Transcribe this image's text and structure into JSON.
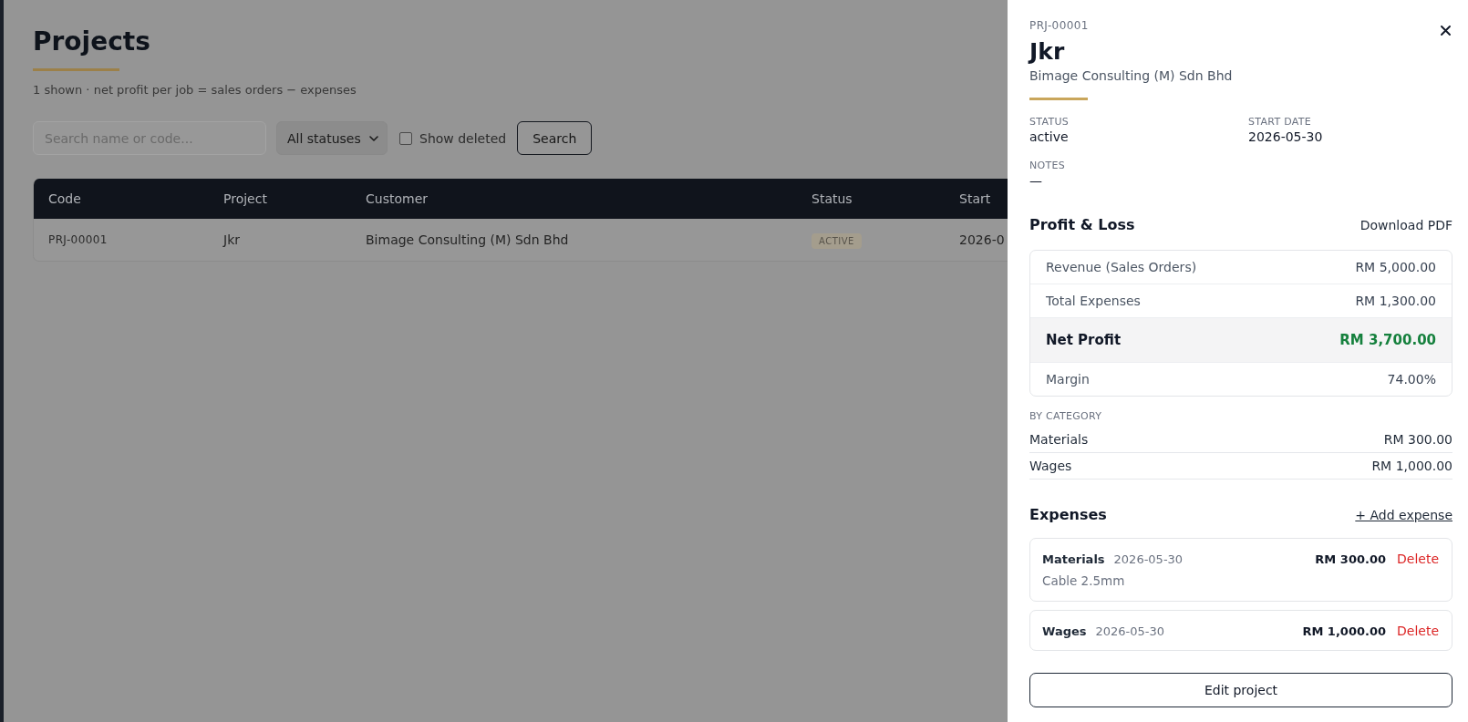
{
  "page": {
    "title": "Projects",
    "subtitle": "1 shown · net profit per job = sales orders − expenses"
  },
  "filters": {
    "search": {
      "placeholder": "Search name or code..."
    },
    "status": {
      "value": "All statuses"
    },
    "show_deleted": {
      "label": "Show deleted",
      "checked": false
    },
    "search_button": "Search"
  },
  "table": {
    "columns": [
      "Code",
      "Project",
      "Customer",
      "Status",
      "Start"
    ],
    "rows": [
      {
        "code": "PRJ-00001",
        "project": "Jkr",
        "customer": "Bimage Consulting (M) Sdn Bhd",
        "status": "ACTIVE",
        "start": "2026-0"
      }
    ]
  },
  "drawer": {
    "code": "PRJ-00001",
    "title": "Jkr",
    "customer": "Bimage Consulting (M) Sdn Bhd",
    "fields": [
      {
        "label": "STATUS",
        "value": "active"
      },
      {
        "label": "START DATE",
        "value": "2026-05-30"
      },
      {
        "label": "NOTES",
        "value": "—"
      }
    ],
    "profit_loss": {
      "title": "Profit & Loss",
      "download": "Download PDF",
      "rows": [
        {
          "kind": "plain",
          "label": "Revenue (Sales Orders)",
          "value": "RM 5,000.00"
        },
        {
          "kind": "plain",
          "label": "Total Expenses",
          "value": "RM 1,300.00"
        },
        {
          "kind": "total",
          "label": "Net Profit",
          "value": "RM 3,700.00"
        },
        {
          "kind": "plain",
          "label": "Margin",
          "value": "74.00%"
        }
      ]
    },
    "by_category": {
      "title": "BY CATEGORY",
      "rows": [
        {
          "label": "Materials",
          "value": "RM 300.00"
        },
        {
          "label": "Wages",
          "value": "RM 1,000.00"
        }
      ]
    },
    "expenses": {
      "title": "Expenses",
      "add": "+ Add expense",
      "items": [
        {
          "category": "Materials",
          "date": "2026-05-30",
          "amount": "RM 300.00",
          "delete": "Delete",
          "note": "Cable 2.5mm"
        },
        {
          "category": "Wages",
          "date": "2026-05-30",
          "amount": "RM 1,000.00",
          "delete": "Delete"
        }
      ]
    },
    "edit_button": "Edit project"
  }
}
